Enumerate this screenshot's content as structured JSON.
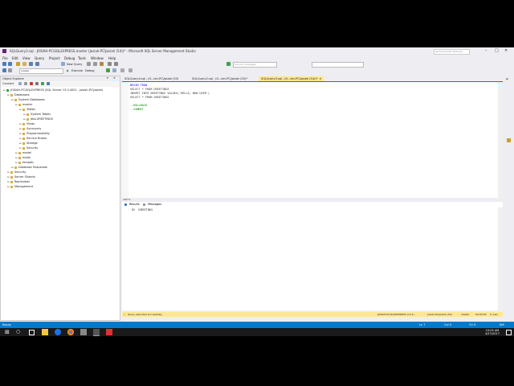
{
  "title": "SQLQuery3.sql - JOSIAH-PC\\SQLEXPRESS.master (Josiah-PC\\Josiah (54))* - Microsoft SQL Server Management Studio",
  "quick_launch": "Quick Launch (Ctrl+Q)",
  "menu": [
    "File",
    "Edit",
    "View",
    "Query",
    "Project",
    "Debug",
    "Tools",
    "Window",
    "Help"
  ],
  "toolbar": {
    "new_query": "New Query",
    "database": "master",
    "execute": "Execute",
    "debug": "Debug",
    "generic_debugger": "Generic Debugger"
  },
  "object_explorer": {
    "title": "Object Explorer",
    "connect": "Connect",
    "tree": [
      {
        "label": "JOSIAH-PC\\SQLEXPRESS (SQL Server 13.0.4001 - Josiah-PC\\Josiah)",
        "level": 0
      },
      {
        "label": "Databases",
        "level": 1
      },
      {
        "label": "System Databases",
        "level": 2
      },
      {
        "label": "master",
        "level": 3
      },
      {
        "label": "Tables",
        "level": 4
      },
      {
        "label": "System Tables",
        "level": 5
      },
      {
        "label": "dbo.GREETINGS",
        "level": 5
      },
      {
        "label": "Views",
        "level": 4
      },
      {
        "label": "Synonyms",
        "level": 4
      },
      {
        "label": "Programmability",
        "level": 4
      },
      {
        "label": "Service Broker",
        "level": 4
      },
      {
        "label": "Storage",
        "level": 4
      },
      {
        "label": "Security",
        "level": 4
      },
      {
        "label": "model",
        "level": 3
      },
      {
        "label": "msdb",
        "level": 3
      },
      {
        "label": "tempdb",
        "level": 3
      },
      {
        "label": "Database Snapshots",
        "level": 2
      },
      {
        "label": "Security",
        "level": 1
      },
      {
        "label": "Server Objects",
        "level": 1
      },
      {
        "label": "Replication",
        "level": 1
      },
      {
        "label": "Management",
        "level": 1
      }
    ]
  },
  "doc_tabs": [
    "SQLQuery4.sql - JO...iah-PC\\Josiah (53)",
    "SQLQuery2.sql - JO...iah-PC\\Josiah (52)*",
    "SQLQuery3.sql - JO...iah-PC\\Josiah (54))*"
  ],
  "code_lines": [
    "BEGIN TRAN",
    "SELECT * FROM GREETINGS",
    "INSERT INTO GREETINGS VALUES('HELLO, NEW USER')",
    "SELECT * FROM GREETINGS",
    "",
    "--ROLLBACK",
    "--COMMIT"
  ],
  "zoom": "100 %",
  "results_tabs": [
    "Results",
    "Messages"
  ],
  "results_header": [
    "ID",
    "GREETING"
  ],
  "query_status": {
    "message": "Query executed successfully.",
    "server": "JOSIAH-PC\\SQLEXPRESS (13.0...",
    "user": "Josiah-PC\\Josiah (54)",
    "db": "master",
    "time": "00:00:00",
    "rows": "0 rows"
  },
  "status_bar": {
    "ready": "Ready",
    "ln": "Ln 7",
    "col": "Col 9",
    "ch": "Ch 9",
    "ins": "INS"
  },
  "clock": {
    "time": "10:05 AM",
    "date": "4/27/2017"
  },
  "colors": {
    "accent": "#007acc",
    "query_bg": "#ffe88c",
    "keyword": "#0000ff",
    "comment": "#008000",
    "string": "#c00000"
  }
}
